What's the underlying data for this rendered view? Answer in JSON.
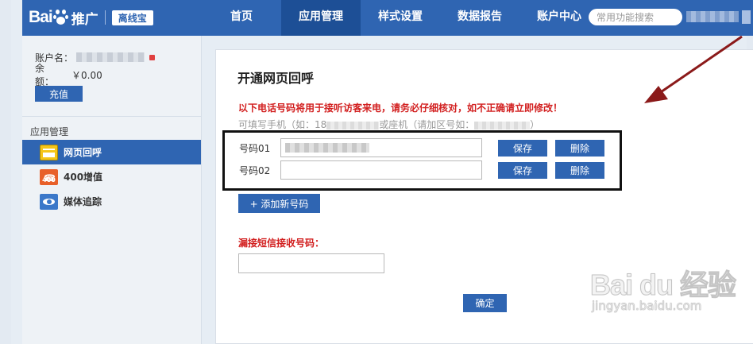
{
  "brand": {
    "logo_text": "Bai",
    "logo_text_2": "du",
    "product": "推广",
    "badge": "离线宝"
  },
  "nav": {
    "tabs": [
      "首页",
      "应用管理",
      "样式设置",
      "数据报告",
      "账户中心"
    ],
    "active": "应用管理"
  },
  "search": {
    "placeholder": "常用功能搜索"
  },
  "account": {
    "name_label": "账户名：",
    "balance_label": "余　额：",
    "balance_value": "￥0.00",
    "recharge_label": "充值"
  },
  "sidebar": {
    "section_title": "应用管理",
    "items": [
      {
        "label": "网页回呼",
        "icon": "web-callback-icon",
        "active": true
      },
      {
        "label": "400增值",
        "icon": "phone-400-icon",
        "active": false
      },
      {
        "label": "媒体追踪",
        "icon": "eye-icon",
        "active": false
      }
    ]
  },
  "main": {
    "title": "开通网页回呼",
    "warning": "以下电话号码将用于接听访客来电，请务必仔细核对，如不正确请立即修改！",
    "hint_prefix": "可填写手机（如：18",
    "hint_middle": "或座机（请加区号如：",
    "hint_suffix": "）",
    "phones": [
      {
        "label": "号码01",
        "value": "",
        "save_label": "保存",
        "delete_label": "删除"
      },
      {
        "label": "号码02",
        "value": "",
        "save_label": "保存",
        "delete_label": "删除"
      }
    ],
    "add_label": "+ 添加新号码",
    "sms_label": "漏接短信接收号码：",
    "sms_value": "",
    "confirm_label": "确定"
  },
  "watermark": {
    "main": "Bai du 经验",
    "url": "jingyan.baidu.com"
  },
  "colors": {
    "primary": "#2f65b2",
    "nav_active": "#1d4f96",
    "warning": "#d21f1f",
    "arrow": "#8b1a1a"
  }
}
